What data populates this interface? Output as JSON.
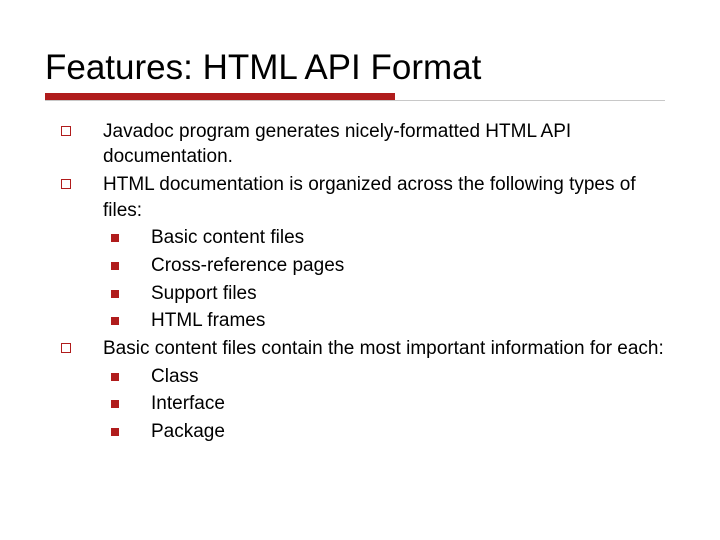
{
  "title": "Features: HTML API Format",
  "bullets": {
    "b1": "Javadoc program generates nicely-formatted HTML API documentation.",
    "b2": "HTML documentation is organized across the following types of files:",
    "b2_sub": {
      "s1": "Basic content files",
      "s2": "Cross-reference pages",
      "s3": "Support files",
      "s4": "HTML frames"
    },
    "b3": "Basic content files contain the most important information for each:",
    "b3_sub": {
      "s1": "Class",
      "s2": "Interface",
      "s3": "Package"
    }
  },
  "colors": {
    "accent": "#b01c1c"
  }
}
